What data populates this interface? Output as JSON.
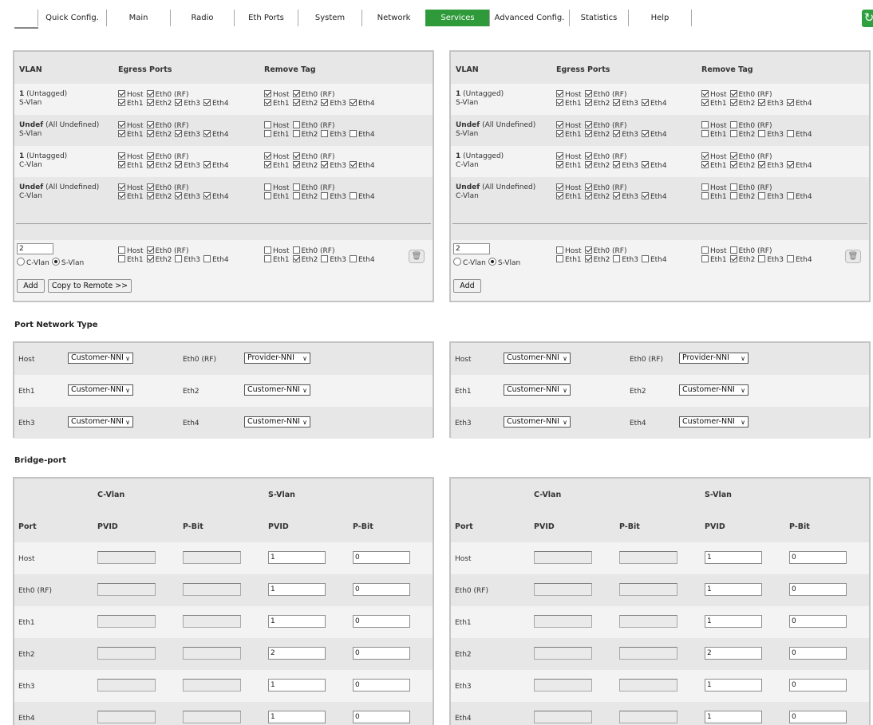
{
  "nav": {
    "tabs": [
      "Quick Config.",
      "Main",
      "Radio",
      "Eth Ports",
      "System",
      "Network",
      "Services",
      "Advanced Config.",
      "Statistics",
      "Help"
    ],
    "active": "Services"
  },
  "vlan": {
    "headers": {
      "vlan": "VLAN",
      "egress": "Egress Ports",
      "remove": "Remove Tag"
    },
    "rows": [
      {
        "id": "1",
        "idnote": "(Untagged)",
        "type": "S-Vlan",
        "egress": [
          true,
          true,
          true,
          true,
          true,
          true
        ],
        "remove": [
          true,
          true,
          true,
          true,
          true,
          true
        ]
      },
      {
        "id": "Undef",
        "idnote": "(All Undefined)",
        "type": "S-Vlan",
        "egress": [
          true,
          true,
          true,
          true,
          true,
          true
        ],
        "remove": [
          false,
          false,
          false,
          false,
          false,
          false
        ]
      },
      {
        "id": "1",
        "idnote": "(Untagged)",
        "type": "C-Vlan",
        "egress": [
          true,
          true,
          true,
          true,
          true,
          true
        ],
        "remove": [
          true,
          true,
          true,
          true,
          true,
          true
        ]
      },
      {
        "id": "Undef",
        "idnote": "(All Undefined)",
        "type": "C-Vlan",
        "egress": [
          true,
          true,
          true,
          true,
          true,
          true
        ],
        "remove": [
          false,
          false,
          false,
          false,
          false,
          false
        ]
      }
    ],
    "port_labels": [
      "Host",
      "Eth0 (RF)",
      "Eth1",
      "Eth2",
      "Eth3",
      "Eth4"
    ],
    "new_row": {
      "vlan_id": "2",
      "radio_c": "C-Vlan",
      "radio_s": "S-Vlan",
      "selected": "S-Vlan",
      "left_egress": [
        false,
        true,
        false,
        true,
        false,
        false
      ],
      "left_remove": [
        false,
        false,
        false,
        true,
        false,
        false
      ],
      "right_egress": [
        false,
        true,
        false,
        true,
        false,
        false
      ],
      "right_remove": [
        false,
        false,
        false,
        true,
        false,
        false
      ]
    },
    "add_label": "Add",
    "copy_label": "Copy to Remote >>"
  },
  "port_network": {
    "title": "Port Network Type",
    "rows": [
      [
        {
          "port": "Host",
          "value": "Customer-NNI"
        },
        {
          "port": "Eth0 (RF)",
          "value": "Provider-NNI"
        }
      ],
      [
        {
          "port": "Eth1",
          "value": "Customer-NNI"
        },
        {
          "port": "Eth2",
          "value": "Customer-NNI"
        }
      ],
      [
        {
          "port": "Eth3",
          "value": "Customer-NNI"
        },
        {
          "port": "Eth4",
          "value": "Customer-NNI"
        }
      ]
    ]
  },
  "bridge": {
    "title": "Bridge-port",
    "cvlan": "C-Vlan",
    "svlan": "S-Vlan",
    "col_port": "Port",
    "col_pvid": "PVID",
    "col_pbit": "P-Bit",
    "rows": [
      {
        "port": "Host",
        "s_pvid": "1",
        "s_pbit": "0"
      },
      {
        "port": "Eth0 (RF)",
        "s_pvid": "1",
        "s_pbit": "0"
      },
      {
        "port": "Eth1",
        "s_pvid": "1",
        "s_pbit": "0"
      },
      {
        "port": "Eth2",
        "s_pvid": "2",
        "s_pbit": "0"
      },
      {
        "port": "Eth3",
        "s_pvid": "1",
        "s_pbit": "0"
      },
      {
        "port": "Eth4",
        "s_pvid": "1",
        "s_pbit": "0"
      }
    ]
  }
}
